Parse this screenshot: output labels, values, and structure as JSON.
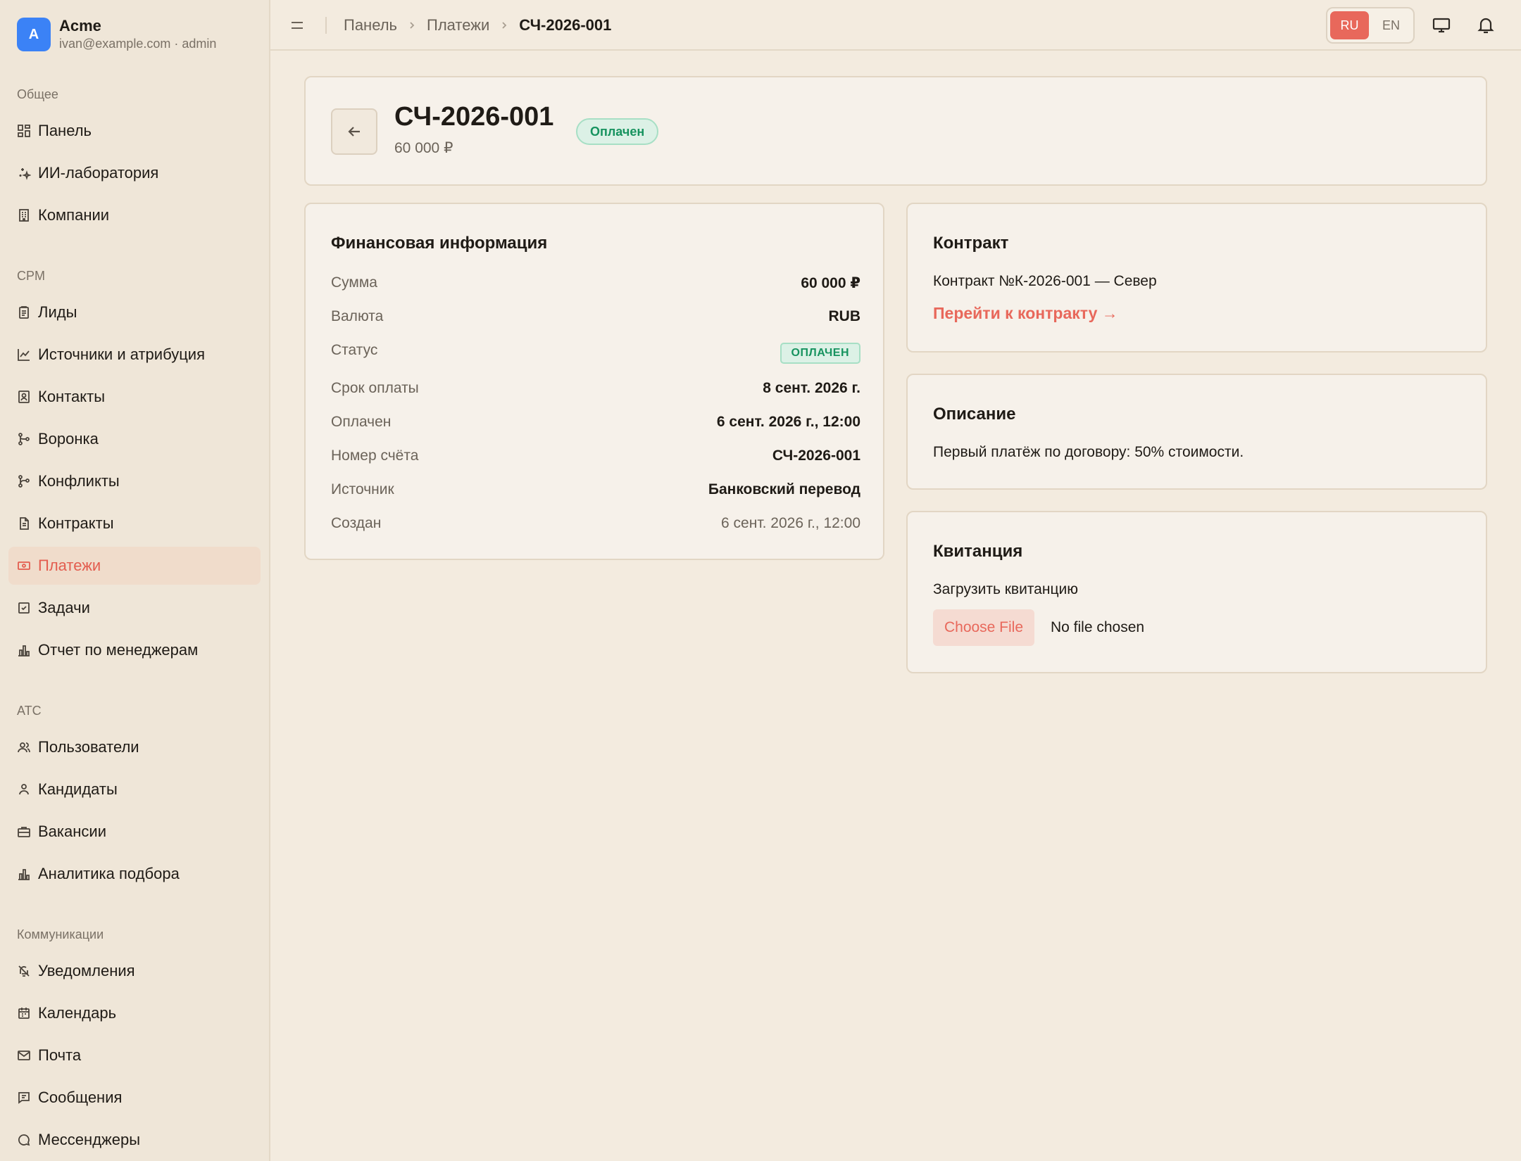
{
  "brand": {
    "initial": "A",
    "name": "Acme",
    "sub": "ivan@example.com · admin"
  },
  "sidebar": {
    "sections": [
      {
        "title": "Общее",
        "items": [
          {
            "label": "Панель",
            "icon": "dashboard-icon"
          },
          {
            "label": "ИИ-лаборатория",
            "icon": "sparkles-icon"
          },
          {
            "label": "Компании",
            "icon": "building-icon"
          }
        ]
      },
      {
        "title": "CPM",
        "items": [
          {
            "label": "Лиды",
            "icon": "clipboard-icon"
          },
          {
            "label": "Источники и атрибуция",
            "icon": "chart-line-icon"
          },
          {
            "label": "Контакты",
            "icon": "contact-card-icon"
          },
          {
            "label": "Воронка",
            "icon": "git-merge-icon"
          },
          {
            "label": "Конфликты",
            "icon": "git-branch-icon"
          },
          {
            "label": "Контракты",
            "icon": "document-icon"
          },
          {
            "label": "Платежи",
            "icon": "payments-icon",
            "active": true
          },
          {
            "label": "Задачи",
            "icon": "checkbox-icon"
          },
          {
            "label": "Отчет по менеджерам",
            "icon": "bar-chart-icon"
          }
        ]
      },
      {
        "title": "ATC",
        "items": [
          {
            "label": "Пользователи",
            "icon": "users-icon"
          },
          {
            "label": "Кандидаты",
            "icon": "user-icon"
          },
          {
            "label": "Вакансии",
            "icon": "briefcase-icon"
          },
          {
            "label": "Аналитика подбора",
            "icon": "bar-chart-icon"
          }
        ]
      },
      {
        "title": "Коммуникации",
        "items": [
          {
            "label": "Уведомления",
            "icon": "bell-off-icon"
          },
          {
            "label": "Календарь",
            "icon": "calendar-icon"
          },
          {
            "label": "Почта",
            "icon": "mail-icon"
          },
          {
            "label": "Сообщения",
            "icon": "message-square-icon"
          },
          {
            "label": "Мессенджеры",
            "icon": "message-circle-icon"
          }
        ]
      }
    ]
  },
  "topbar": {
    "breadcrumb": [
      "Панель",
      "Платежи",
      "СЧ-2026-001"
    ],
    "lang": {
      "ru": "RU",
      "en": "EN",
      "active": "RU"
    }
  },
  "header": {
    "title": "СЧ-2026-001",
    "amount": "60 000 ₽",
    "status": "Оплачен"
  },
  "finance": {
    "title": "Финансовая информация",
    "rows": [
      {
        "label": "Сумма",
        "value": "60 000 ₽"
      },
      {
        "label": "Валюта",
        "value": "RUB"
      },
      {
        "label": "Статус",
        "value": "ОПЛАЧЕН"
      },
      {
        "label": "Срок оплаты",
        "value": "8 сент. 2026 г."
      },
      {
        "label": "Оплачен",
        "value": "6 сент. 2026 г., 12:00"
      },
      {
        "label": "Номер счёта",
        "value": "СЧ-2026-001"
      },
      {
        "label": "Источник",
        "value": "Банковский перевод"
      },
      {
        "label": "Создан",
        "value": "6 сент. 2026 г., 12:00"
      }
    ]
  },
  "contract": {
    "title": "Контракт",
    "name": "Контракт №К-2026-001 — Север",
    "link": "Перейти к контракту →"
  },
  "description": {
    "title": "Описание",
    "text": "Первый платёж по договору: 50% стоимости."
  },
  "receipt": {
    "title": "Квитанция",
    "label": "Загрузить квитанцию",
    "button": "Choose File",
    "status": "No file chosen"
  },
  "colors": {
    "accent": "#e8685b",
    "brand": "#3b82f6",
    "success": "#17935f",
    "background": "#f3ebdf"
  }
}
